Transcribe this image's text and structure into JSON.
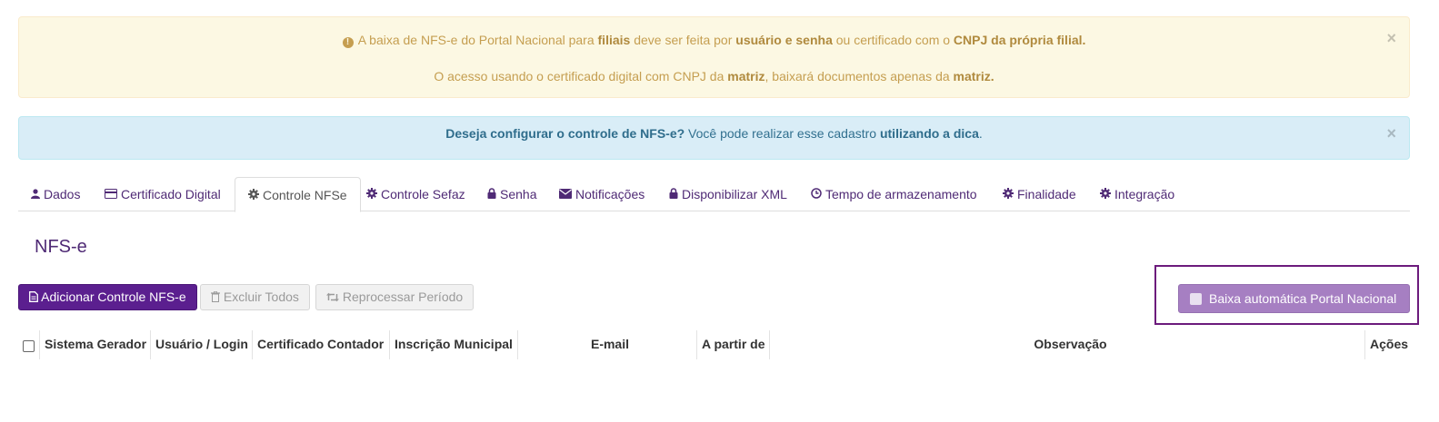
{
  "alerts": {
    "warning": {
      "icon": "exclamation-circle-icon",
      "line1": [
        {
          "t": "A baixa de NFS-e do Portal Nacional para ",
          "b": false
        },
        {
          "t": "filiais",
          "b": true
        },
        {
          "t": " deve ser feita por ",
          "b": false
        },
        {
          "t": "usuário e senha",
          "b": true
        },
        {
          "t": " ou certificado com o ",
          "b": false
        },
        {
          "t": "CNPJ da própria filial.",
          "b": true
        }
      ],
      "line2": [
        {
          "t": "O acesso usando o certificado digital com CNPJ da ",
          "b": false
        },
        {
          "t": "matriz",
          "b": true
        },
        {
          "t": ", baixará documentos apenas da ",
          "b": false
        },
        {
          "t": "matriz.",
          "b": true
        }
      ],
      "close": "×"
    },
    "info": {
      "line1": [
        {
          "t": "Deseja configurar o controle de NFS-e?",
          "b": true
        },
        {
          "t": " Você pode realizar esse cadastro ",
          "b": false
        },
        {
          "t": "utilizando a dica",
          "b": true
        },
        {
          "t": ".",
          "b": false
        }
      ],
      "close": "×"
    }
  },
  "tabs": [
    {
      "label": "Dados",
      "icon": "user-icon"
    },
    {
      "label": "Certificado Digital",
      "icon": "credit-card-icon"
    },
    {
      "label": "Controle NFSe",
      "icon": "gear-icon",
      "active": true
    },
    {
      "label": "Controle Sefaz",
      "icon": "gear-icon"
    },
    {
      "label": "Senha",
      "icon": "lock-icon"
    },
    {
      "label": "Notificações",
      "icon": "envelope-icon"
    },
    {
      "label": "Disponibilizar XML",
      "icon": "lock-icon"
    },
    {
      "label": "Tempo de armazenamento",
      "icon": "clock-icon"
    },
    {
      "label": "Finalidade",
      "icon": "gear-icon"
    },
    {
      "label": "Integração",
      "icon": "gear-icon"
    }
  ],
  "page_title": "NFS-e",
  "toolbar": {
    "add_label": "Adicionar Controle NFS-e",
    "delete_all_label": "Excluir Todos",
    "reprocess_label": "Reprocessar Período",
    "auto_download_label": "Baixa automática Portal Nacional"
  },
  "table": {
    "columns": [
      "Sistema Gerador",
      "Usuário / Login",
      "Certificado Contador",
      "Inscrição Municipal",
      "E-mail",
      "A partir de",
      "Observação",
      "Ações"
    ]
  }
}
